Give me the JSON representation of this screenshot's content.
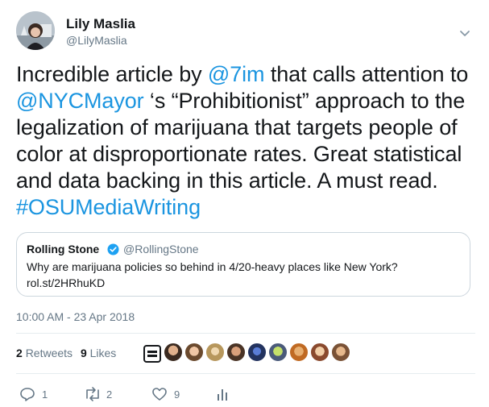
{
  "author": {
    "name": "Lily Maslia",
    "handle": "@LilyMaslia"
  },
  "tweet": {
    "parts": [
      {
        "t": "Incredible article by ",
        "link": false
      },
      {
        "t": "@7im",
        "link": true
      },
      {
        "t": " that calls attention to ",
        "link": false
      },
      {
        "t": "@NYCMayor",
        "link": true
      },
      {
        "t": " ‘s “Prohibitionist” approach to the legalization of marijuana that targets people of color at disproportionate rates. Great statistical and data backing in this article. A must read. ",
        "link": false
      },
      {
        "t": "#OSUMediaWriting",
        "link": true
      }
    ]
  },
  "quote": {
    "name": "Rolling Stone",
    "handle": "@RollingStone",
    "text": "Why are marijuana policies so behind in 4/20-heavy places like New York? rol.st/2HRhuKD"
  },
  "timestamp": "10:00 AM - 23 Apr 2018",
  "stats": {
    "retweets_count": "2",
    "retweets_label": "Retweets",
    "likes_count": "9",
    "likes_label": "Likes"
  },
  "actions": {
    "reply_count": "1",
    "retweet_count": "2",
    "like_count": "9"
  },
  "icons": {
    "caret": "chevron-down-icon",
    "verified": "verified-badge-icon",
    "reply": "reply-icon",
    "retweet": "retweet-icon",
    "like": "heart-icon",
    "analytics": "analytics-icon"
  },
  "colors": {
    "link": "#1b95e0",
    "secondary_text": "#657786",
    "border": "#ccd6dd"
  }
}
